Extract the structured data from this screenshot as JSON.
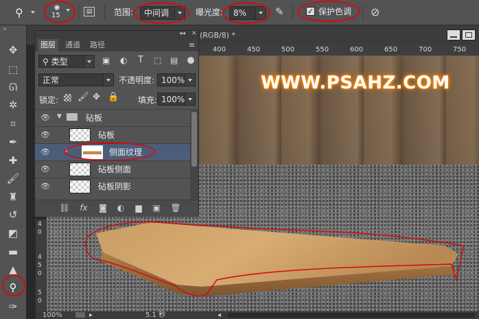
{
  "options": {
    "brush_size": "15",
    "range_label": "范围:",
    "range_value": "中间调",
    "exposure_label": "曝光度:",
    "exposure_value": "8%",
    "protect_label": "保护色调",
    "protect_checked": true
  },
  "document": {
    "tab_title": "(RGB/8) *",
    "ruler_top": [
      "400",
      "450",
      "500",
      "550",
      "600",
      "650",
      "700",
      "750"
    ],
    "ruler_left": [
      "4",
      "0",
      "4",
      "5",
      "0",
      "5",
      "0"
    ],
    "watermark": "WWW.PSAHZ.COM"
  },
  "status": {
    "zoom": "100%",
    "time": "5.1 秒"
  },
  "layers_panel": {
    "tabs": [
      "图层",
      "通道",
      "路径"
    ],
    "filter_kind": "类型",
    "blend_mode": "正常",
    "opacity_label": "不透明度:",
    "opacity_value": "100%",
    "lock_label": "锁定:",
    "fill_label": "填充:",
    "fill_value": "100%",
    "group_name": "砧板",
    "layers": [
      {
        "name": "砧板"
      },
      {
        "name": "侧面纹理",
        "clipped": true,
        "selected": true
      },
      {
        "name": "砧板侧面"
      },
      {
        "name": "砧板阴影"
      }
    ]
  },
  "colors": {
    "annotation_red": "#d40b0b",
    "panel_bg": "#535353",
    "selected_row": "#4b5d78"
  }
}
